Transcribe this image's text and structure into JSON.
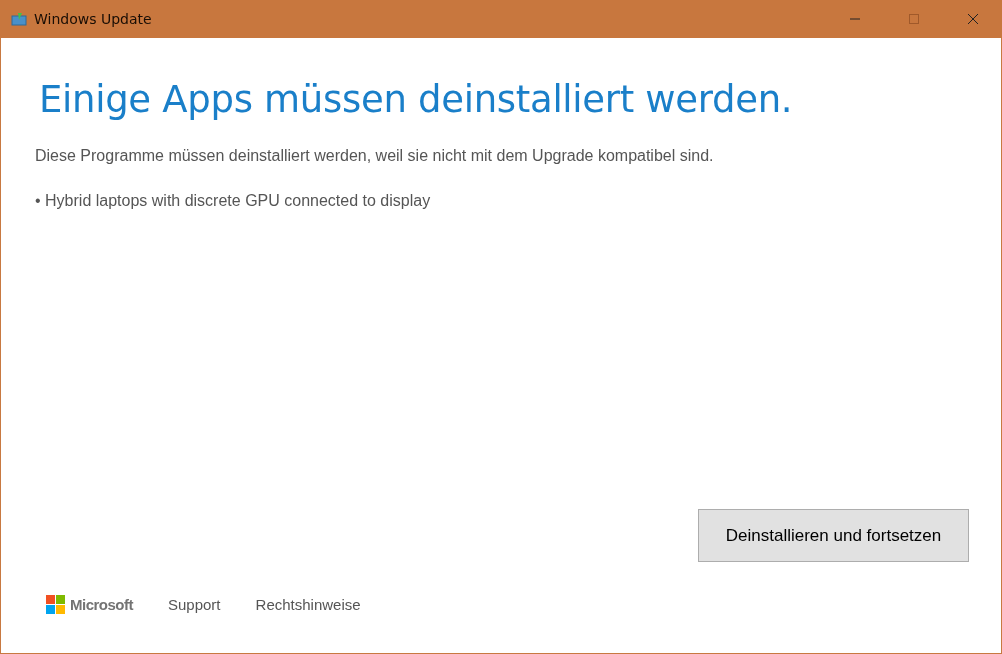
{
  "window": {
    "title": "Windows Update",
    "controls": [
      {
        "kind": "minimize",
        "disabled": false
      },
      {
        "kind": "maximize",
        "disabled": true
      },
      {
        "kind": "close",
        "disabled": false
      }
    ]
  },
  "heading": "Einige Apps müssen deinstalliert werden.",
  "description": "Diese Programme müssen deinstalliert werden, weil sie nicht mit dem Upgrade kompatibel sind.",
  "apps": [
    "• Hybrid laptops with discrete GPU connected to display"
  ],
  "primary_button": "Deinstallieren und fortsetzen",
  "footer": {
    "brand": "Microsoft",
    "links": [
      "Support",
      "Rechtshinweise"
    ]
  }
}
